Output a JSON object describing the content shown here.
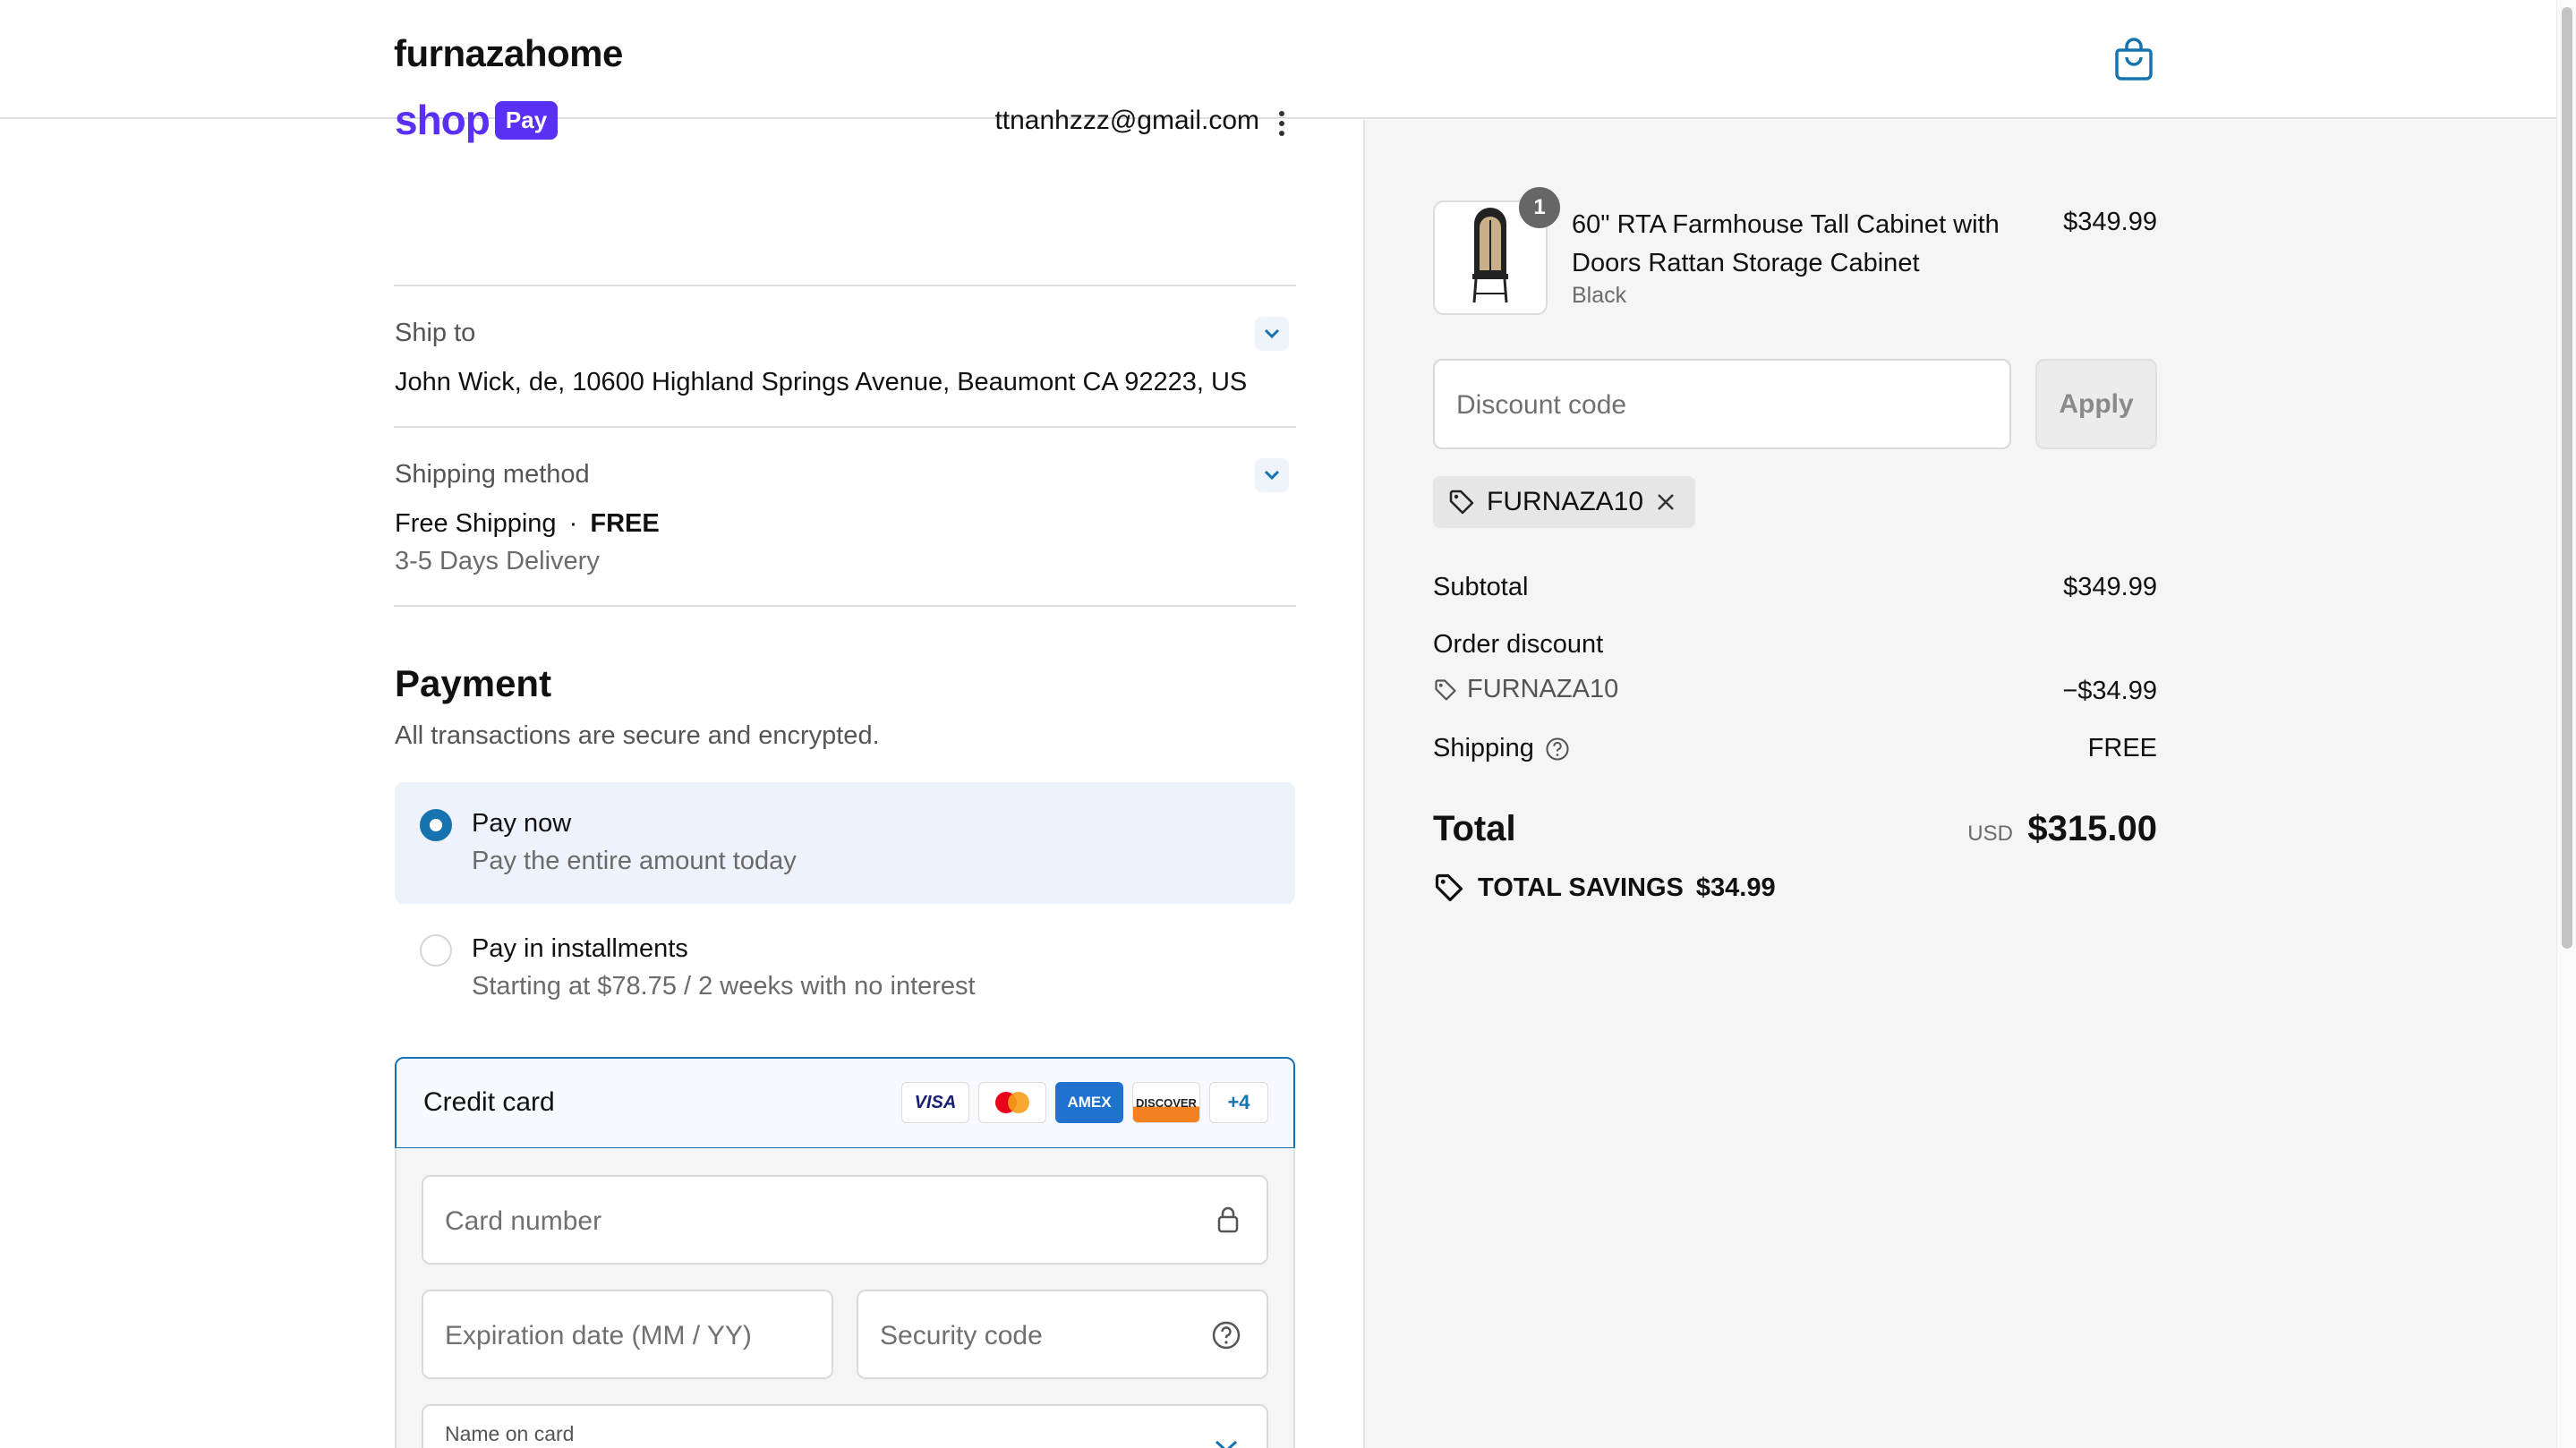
{
  "header": {
    "brand": "furnazahome",
    "cart_icon": "shopping-bag-icon"
  },
  "account": {
    "shop_pay_word": "shop",
    "shop_pay_pill": "Pay",
    "email": "ttnanhzzz@gmail.com"
  },
  "ship_to": {
    "label": "Ship to",
    "address": "John Wick, de, 10600 Highland Springs Avenue, Beaumont CA 92223, US"
  },
  "shipping_method": {
    "label": "Shipping method",
    "name": "Free Shipping",
    "separator": "·",
    "price": "FREE",
    "eta": "3-5 Days Delivery"
  },
  "payment": {
    "title": "Payment",
    "subtitle": "All transactions are secure and encrypted.",
    "options": [
      {
        "title": "Pay now",
        "subtitle": "Pay the entire amount today",
        "selected": true
      },
      {
        "title": "Pay in installments",
        "subtitle": "Starting at $78.75 / 2 weeks with no interest",
        "selected": false
      }
    ],
    "credit_card": {
      "label": "Credit card",
      "brands": [
        "VISA",
        "MC",
        "AMEX",
        "DISCOVER"
      ],
      "more": "+4",
      "card_number_placeholder": "Card number",
      "expiry_placeholder": "Expiration date (MM / YY)",
      "security_placeholder": "Security code",
      "name_label": "Name on card"
    }
  },
  "order": {
    "quantity": "1",
    "product_name": "60\" RTA Farmhouse Tall Cabinet with Doors Rattan Storage Cabinet",
    "variant": "Black",
    "price": "$349.99",
    "discount_placeholder": "Discount code",
    "apply_label": "Apply",
    "applied_code": "FURNAZA10",
    "subtotal_label": "Subtotal",
    "subtotal_value": "$349.99",
    "order_discount_label": "Order discount",
    "discount_code": "FURNAZA10",
    "discount_value": "−$34.99",
    "shipping_label": "Shipping",
    "shipping_value": "FREE",
    "total_label": "Total",
    "total_currency": "USD",
    "total_value": "$315.00",
    "savings_label": "TOTAL SAVINGS",
    "savings_value": "$34.99"
  },
  "colors": {
    "accent": "#1773b0",
    "shop_pay": "#5a31f4",
    "summary_bg": "#f5f5f5"
  }
}
